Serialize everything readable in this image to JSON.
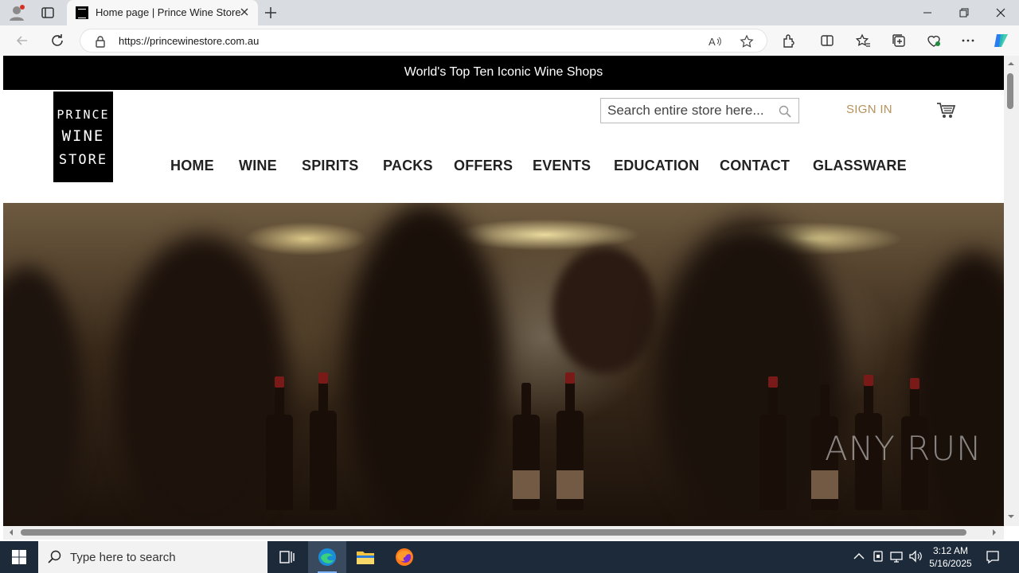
{
  "browser": {
    "tab_title": "Home page | Prince Wine Store",
    "url": "https://princewinestore.com.au"
  },
  "site": {
    "promo_text": "World's Top Ten Iconic Wine Shops",
    "logo_lines": [
      "PRINCE",
      "WINE",
      "STORE"
    ],
    "search_placeholder": "Search entire store here...",
    "sign_in": "SIGN IN",
    "nav": [
      "HOME",
      "WINE",
      "SPIRITS",
      "PACKS",
      "OFFERS",
      "EVENTS",
      "EDUCATION",
      "CONTACT",
      "GLASSWARE"
    ],
    "accent_color": "#b6925a"
  },
  "watermark": "ANY RUN",
  "taskbar": {
    "search_placeholder": "Type here to search",
    "time": "3:12 AM",
    "date": "5/16/2025"
  }
}
